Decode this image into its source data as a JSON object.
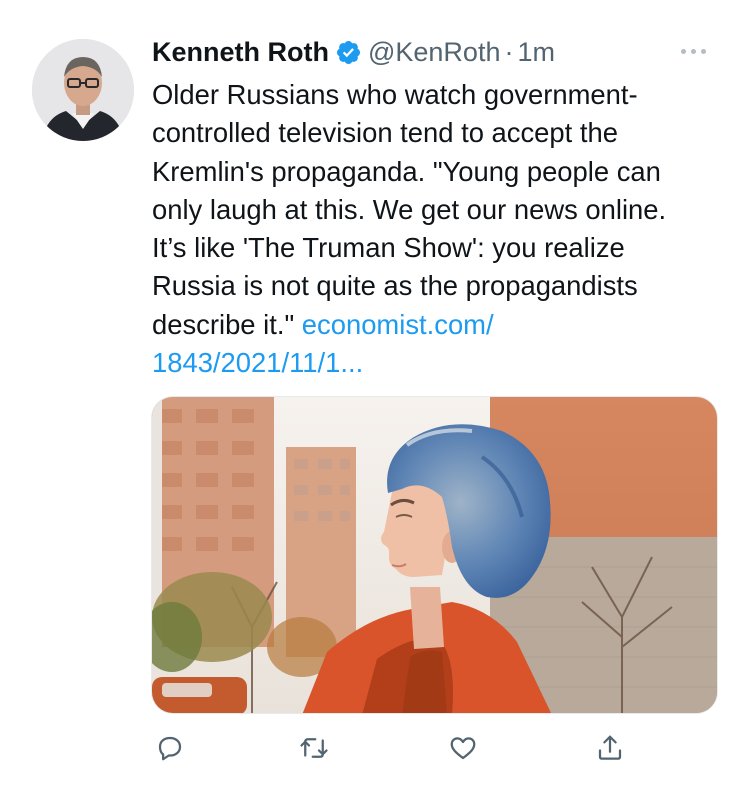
{
  "tweet": {
    "author_name": "Kenneth Roth",
    "handle": "@KenRoth",
    "separator": "·",
    "time": "1m",
    "text_lines": [
      "Older Russians who watch government-",
      "controlled television tend to accept the",
      "Kremlin's propaganda. \"Young people can",
      "only laugh at this. We get our news online.",
      "It’s like 'The Truman Show': you realize",
      "Russia is not quite as the propagandists"
    ],
    "text_line_7": "describe it.\"",
    "link_part_1": "economist.com/",
    "link_part_2": "1843/2021/11/1..."
  },
  "icons": {
    "verified": "verified-badge-icon",
    "more": "more-options-icon",
    "reply": "reply-icon",
    "retweet": "retweet-icon",
    "like": "like-icon",
    "share": "share-icon"
  },
  "colors": {
    "text": "#0f1419",
    "secondary": "#536471",
    "link": "#1d9bf0",
    "verified": "#1d9bf0"
  }
}
